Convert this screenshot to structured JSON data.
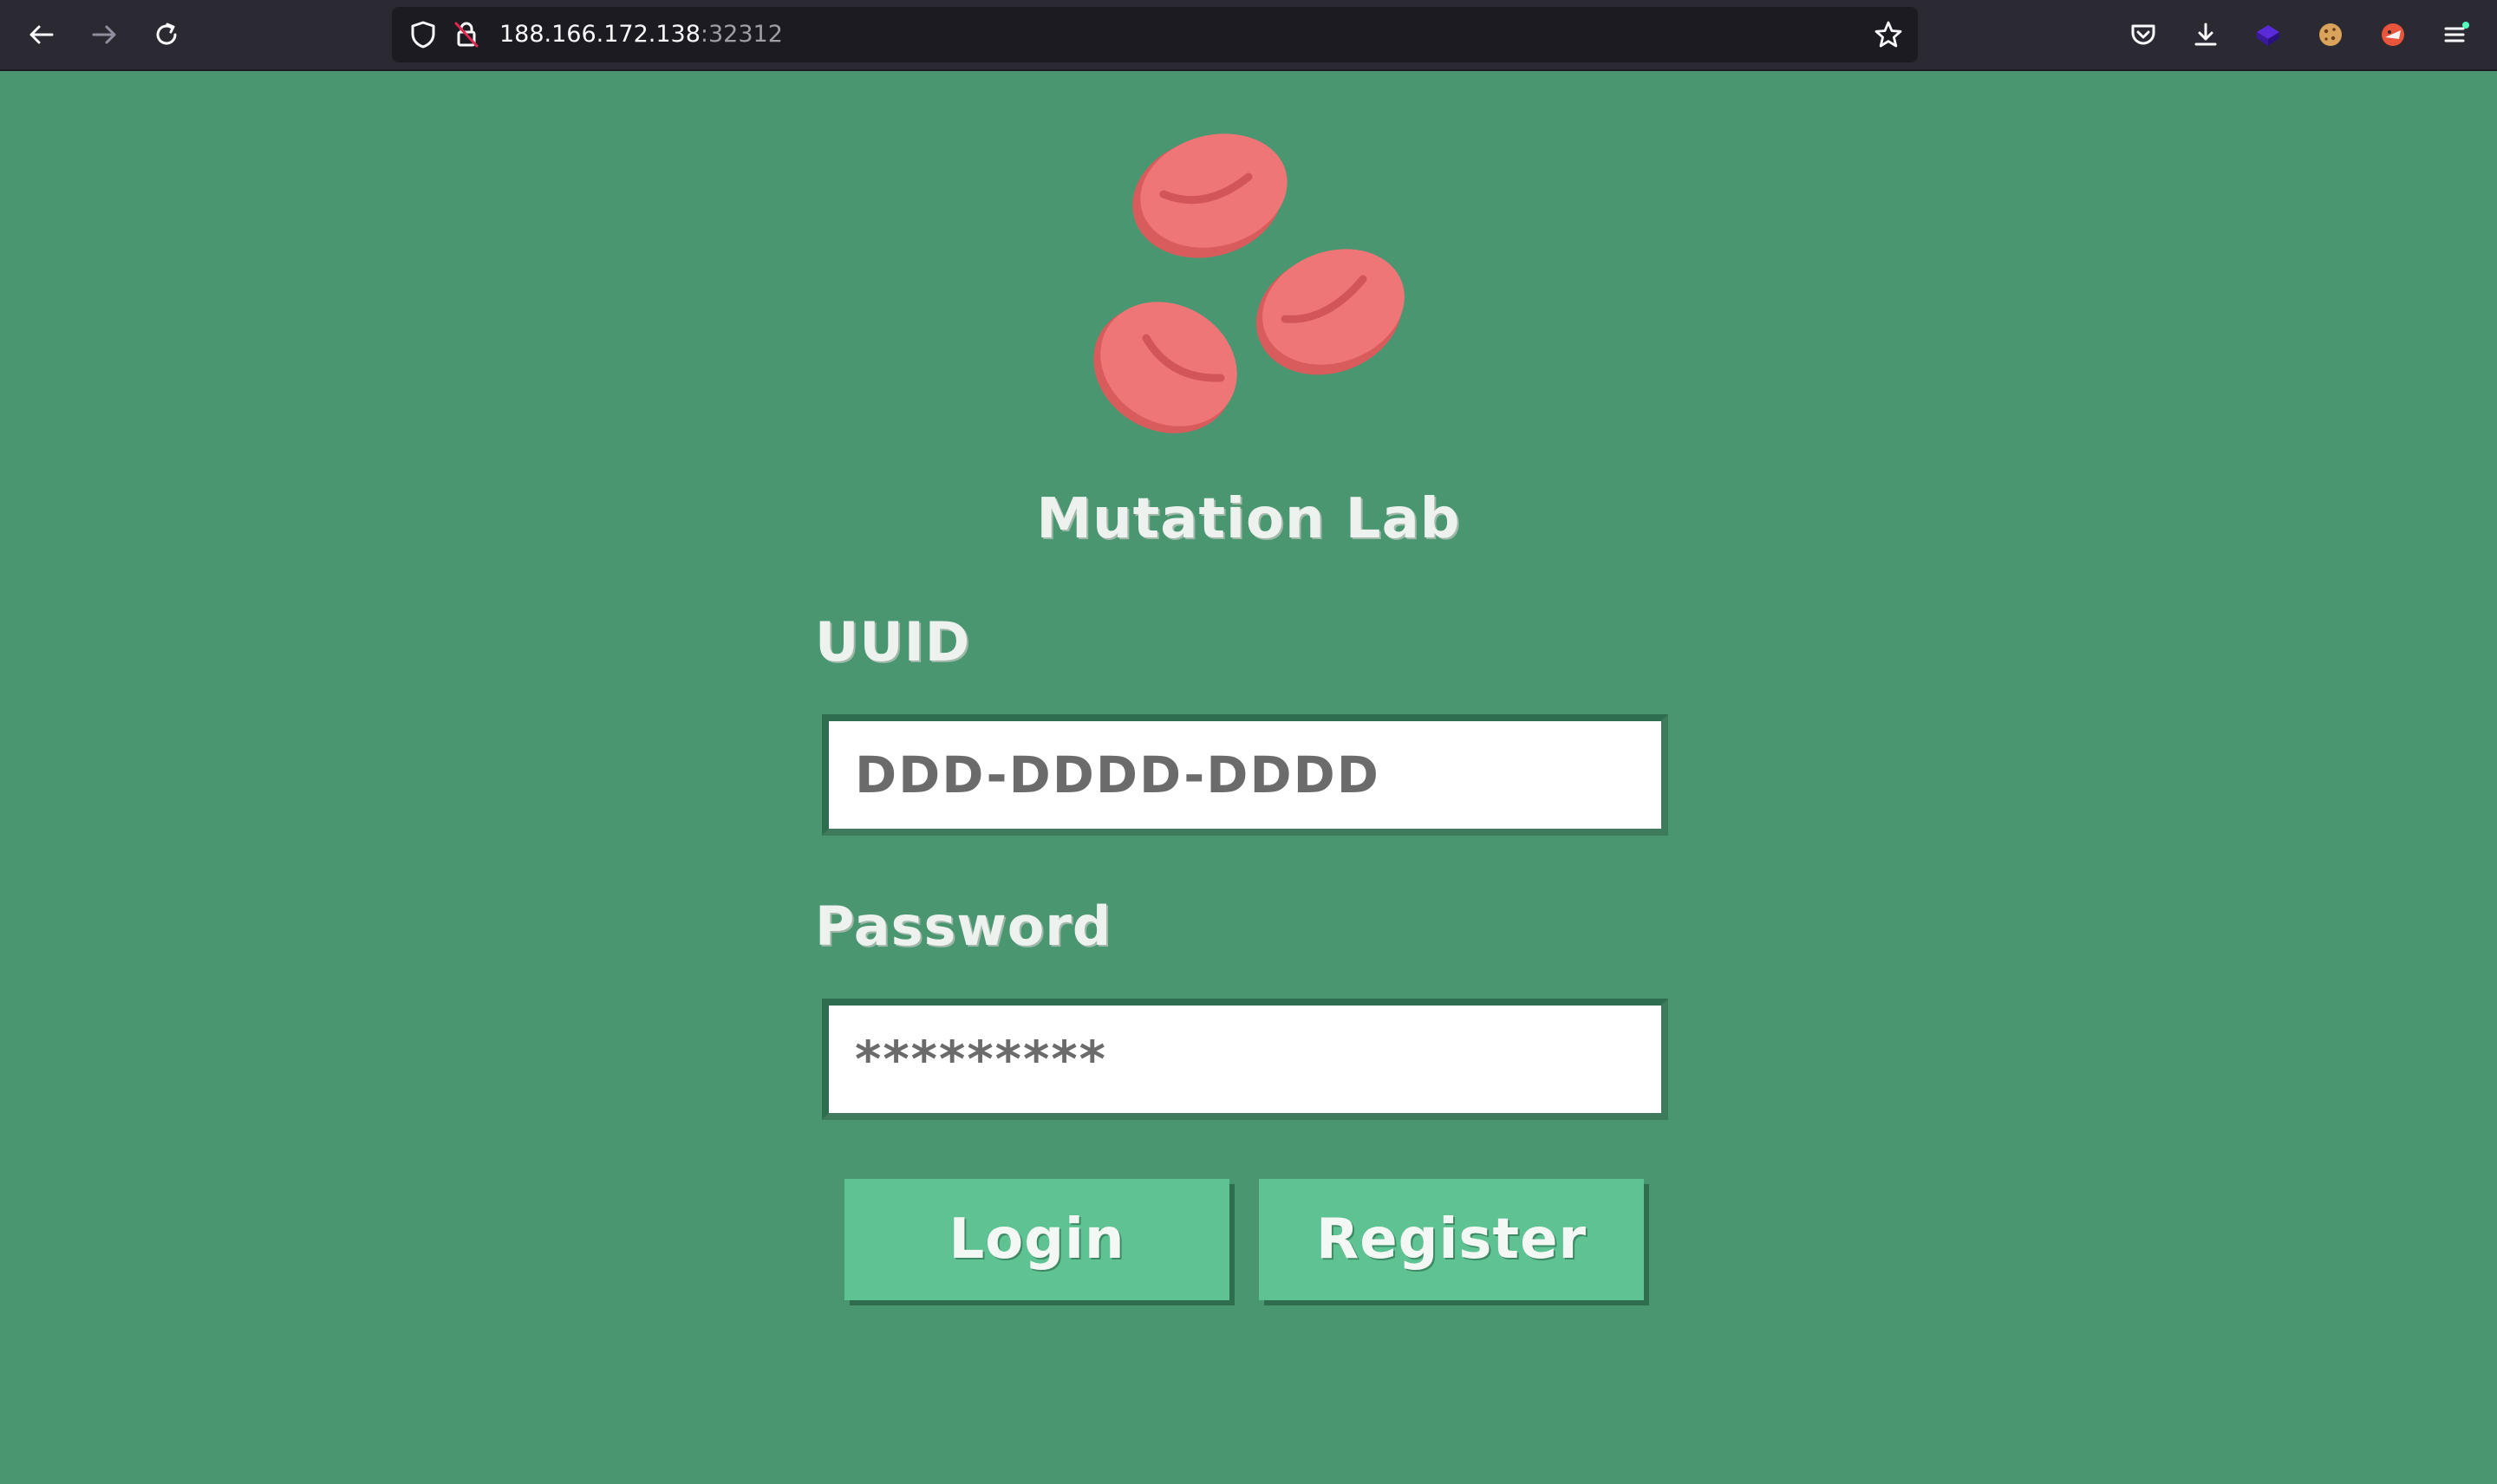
{
  "browser": {
    "url_host": "188.166.172.138",
    "url_port": ":32312",
    "icons": {
      "back": "arrow-left-icon",
      "forward": "arrow-right-icon",
      "reload": "reload-icon",
      "tracking": "shield-icon",
      "insecure": "insecure-lock-icon",
      "bookmark": "star-icon",
      "pocket": "pocket-icon",
      "downloads": "download-icon",
      "menu": "hamburger-menu-icon"
    }
  },
  "app": {
    "title": "Mutation Lab",
    "logo": "red-blood-cells-logo"
  },
  "form": {
    "uuid_label": "UUID",
    "uuid_placeholder": "DDD-DDDD-DDDD",
    "password_label": "Password",
    "password_placeholder": "*********",
    "login_label": "Login",
    "register_label": "Register"
  },
  "colors": {
    "page_bg": "#4a9670",
    "button_bg": "#5fc293",
    "cell_red": "#ef7676"
  }
}
